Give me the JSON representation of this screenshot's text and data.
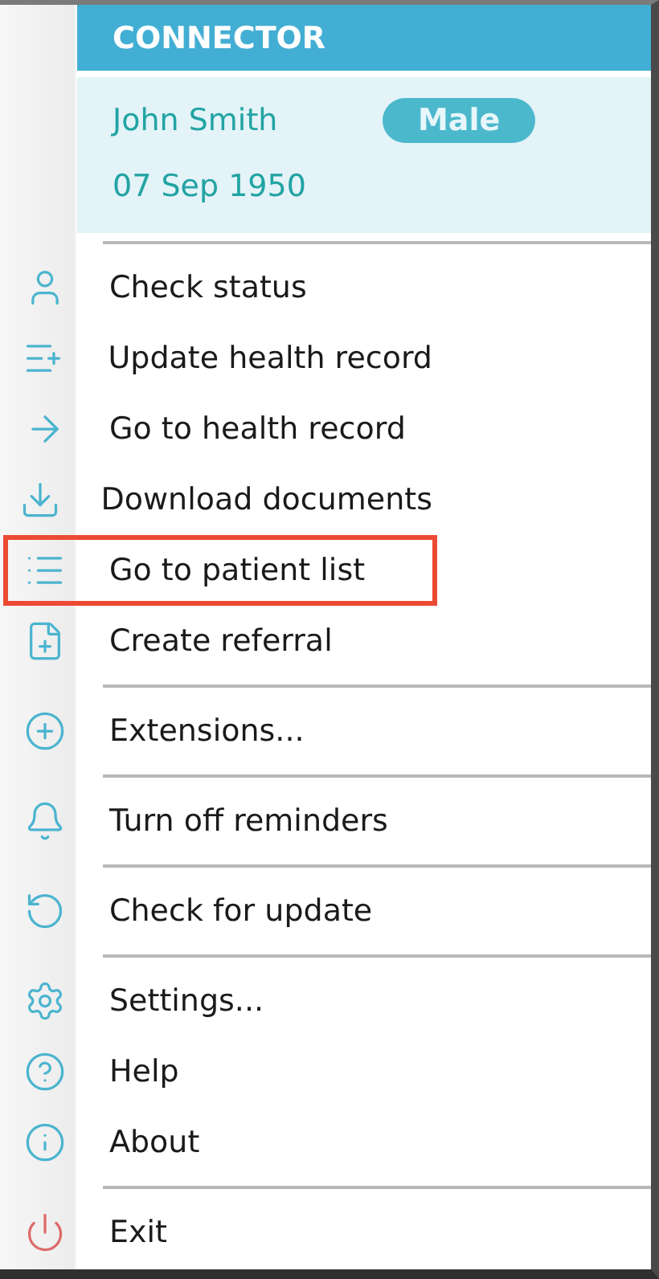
{
  "header": {
    "title": "CONNECTOR"
  },
  "patient": {
    "name": "John Smith",
    "dob": "07 Sep 1950",
    "gender": "Male"
  },
  "menu_groups": [
    {
      "items": [
        {
          "label": "Check status",
          "selected": false
        },
        {
          "label": "Update health record",
          "selected": false
        },
        {
          "label": "Go to health record",
          "selected": false
        },
        {
          "label": "Download documents",
          "selected": false
        },
        {
          "label": "Go to patient list",
          "selected": true
        },
        {
          "label": "Create referral",
          "selected": false
        }
      ]
    },
    {
      "items": [
        {
          "label": "Extensions...",
          "selected": false
        }
      ]
    },
    {
      "items": [
        {
          "label": "Turn off reminders",
          "selected": false
        }
      ]
    },
    {
      "items": [
        {
          "label": "Check for update",
          "selected": false
        }
      ]
    },
    {
      "items": [
        {
          "label": "Settings...",
          "selected": false
        },
        {
          "label": "Help",
          "selected": false
        },
        {
          "label": "About",
          "selected": false
        }
      ]
    },
    {
      "items": [
        {
          "label": "Exit",
          "selected": false
        }
      ]
    }
  ]
}
